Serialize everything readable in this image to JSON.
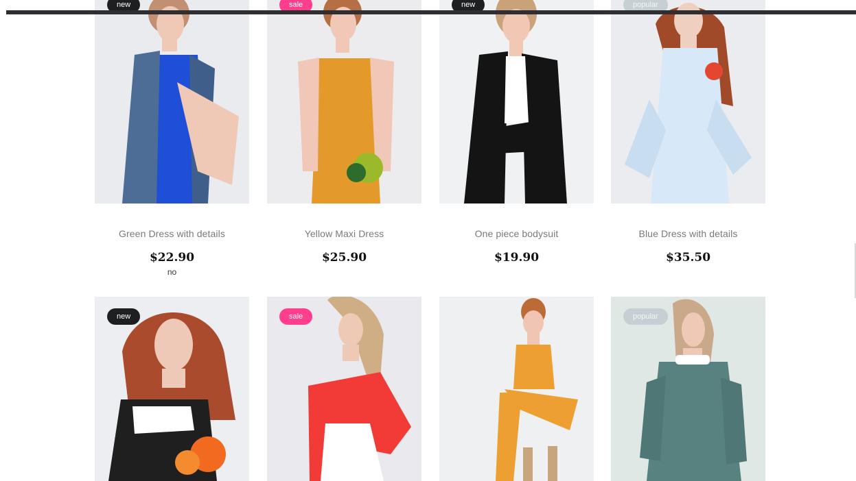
{
  "products": [
    {
      "badge": "new",
      "name": "Green Dress with details",
      "price": "$22.90",
      "note": "no",
      "colors": {
        "bg": "#e9ebef",
        "skin": "#efc8b6",
        "hair": "#c38f73",
        "outfit": "#1e4fd6",
        "accent": "#4d6c96"
      }
    },
    {
      "badge": "sale",
      "name": "Yellow Maxi Dress",
      "price": "$25.90",
      "note": "",
      "colors": {
        "bg": "#ececef",
        "skin": "#f1c8b8",
        "hair": "#b66f44",
        "outfit": "#e49a2b",
        "accent": "#9ab92b"
      }
    },
    {
      "badge": "new",
      "name": "One piece bodysuit",
      "price": "$19.90",
      "note": "",
      "colors": {
        "bg": "#f0f1f3",
        "skin": "#f0c8b3",
        "hair": "#caa27a",
        "outfit": "#141414",
        "accent": "#ffffff"
      }
    },
    {
      "badge": "popular",
      "name": "Blue Dress with details",
      "price": "$35.50",
      "note": "",
      "colors": {
        "bg": "#eaecef",
        "skin": "#efcfbf",
        "hair": "#a14a2a",
        "outfit": "#d7e8f8",
        "accent": "#e44731"
      }
    },
    {
      "badge": "new",
      "name": "",
      "price": "",
      "note": "",
      "colors": {
        "bg": "#eceef1",
        "skin": "#efc9b7",
        "hair": "#a94b2c",
        "outfit": "#1f1f1f",
        "accent": "#f16a20"
      }
    },
    {
      "badge": "sale",
      "name": "",
      "price": "",
      "note": "",
      "colors": {
        "bg": "#e9e9ee",
        "skin": "#edc9b6",
        "hair": "#cfae86",
        "outfit": "#f23b36",
        "accent": "#ffffff"
      }
    },
    {
      "badge": "",
      "name": "",
      "price": "",
      "note": "",
      "colors": {
        "bg": "#eef0f2",
        "skin": "#f1c5b3",
        "hair": "#bc6b37",
        "outfit": "#eda031",
        "accent": "#c8a57d"
      }
    },
    {
      "badge": "popular",
      "name": "",
      "price": "",
      "note": "",
      "colors": {
        "bg": "#dfe8e4",
        "skin": "#efc9b6",
        "hair": "#caa88a",
        "outfit": "#58827f",
        "accent": "#ffffff"
      }
    }
  ]
}
